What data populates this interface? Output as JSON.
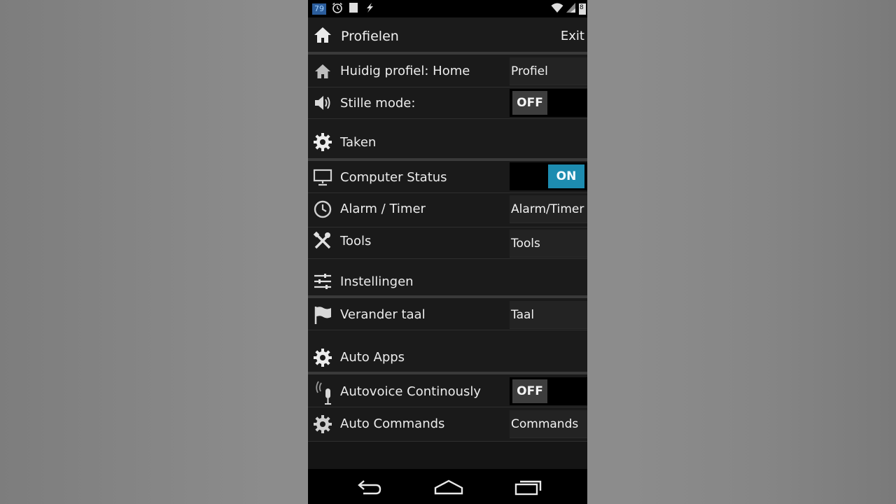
{
  "status_bar": {
    "badge": "79",
    "icons_left": [
      "alarm-icon",
      "notification-icon",
      "flash-icon"
    ],
    "icons_right": [
      "wifi-icon",
      "signal-icon",
      "battery-icon"
    ],
    "battery_text": "8"
  },
  "header": {
    "title": "Profielen",
    "exit_label": "Exit"
  },
  "rows": {
    "current_profile": {
      "label": "Huidig profiel: Home",
      "button": "Profiel"
    },
    "silent_mode": {
      "label": "Stille mode:",
      "toggle": "OFF"
    },
    "tasks_section": {
      "label": "Taken"
    },
    "computer_status": {
      "label": "Computer Status",
      "toggle": "ON"
    },
    "alarm_timer": {
      "label": "Alarm / Timer",
      "button": "Alarm/Timer"
    },
    "tools": {
      "label": "Tools",
      "button": "Tools"
    },
    "settings_section": {
      "label": "Instellingen"
    },
    "change_language": {
      "label": "Verander taal",
      "button": "Taal"
    },
    "auto_apps_section": {
      "label": "Auto Apps"
    },
    "autovoice": {
      "label": "Autovoice Continously",
      "toggle": "OFF"
    },
    "auto_commands": {
      "label": "Auto Commands",
      "button": "Commands"
    }
  },
  "nav_bar": {
    "buttons": [
      "back-icon",
      "home-icon",
      "recent-apps-icon"
    ]
  },
  "colors": {
    "toggle_on": "#1d8cb0",
    "toggle_off": "#3d3d3d",
    "background": "#1a1a1a",
    "separator": "#3a3a3a"
  }
}
